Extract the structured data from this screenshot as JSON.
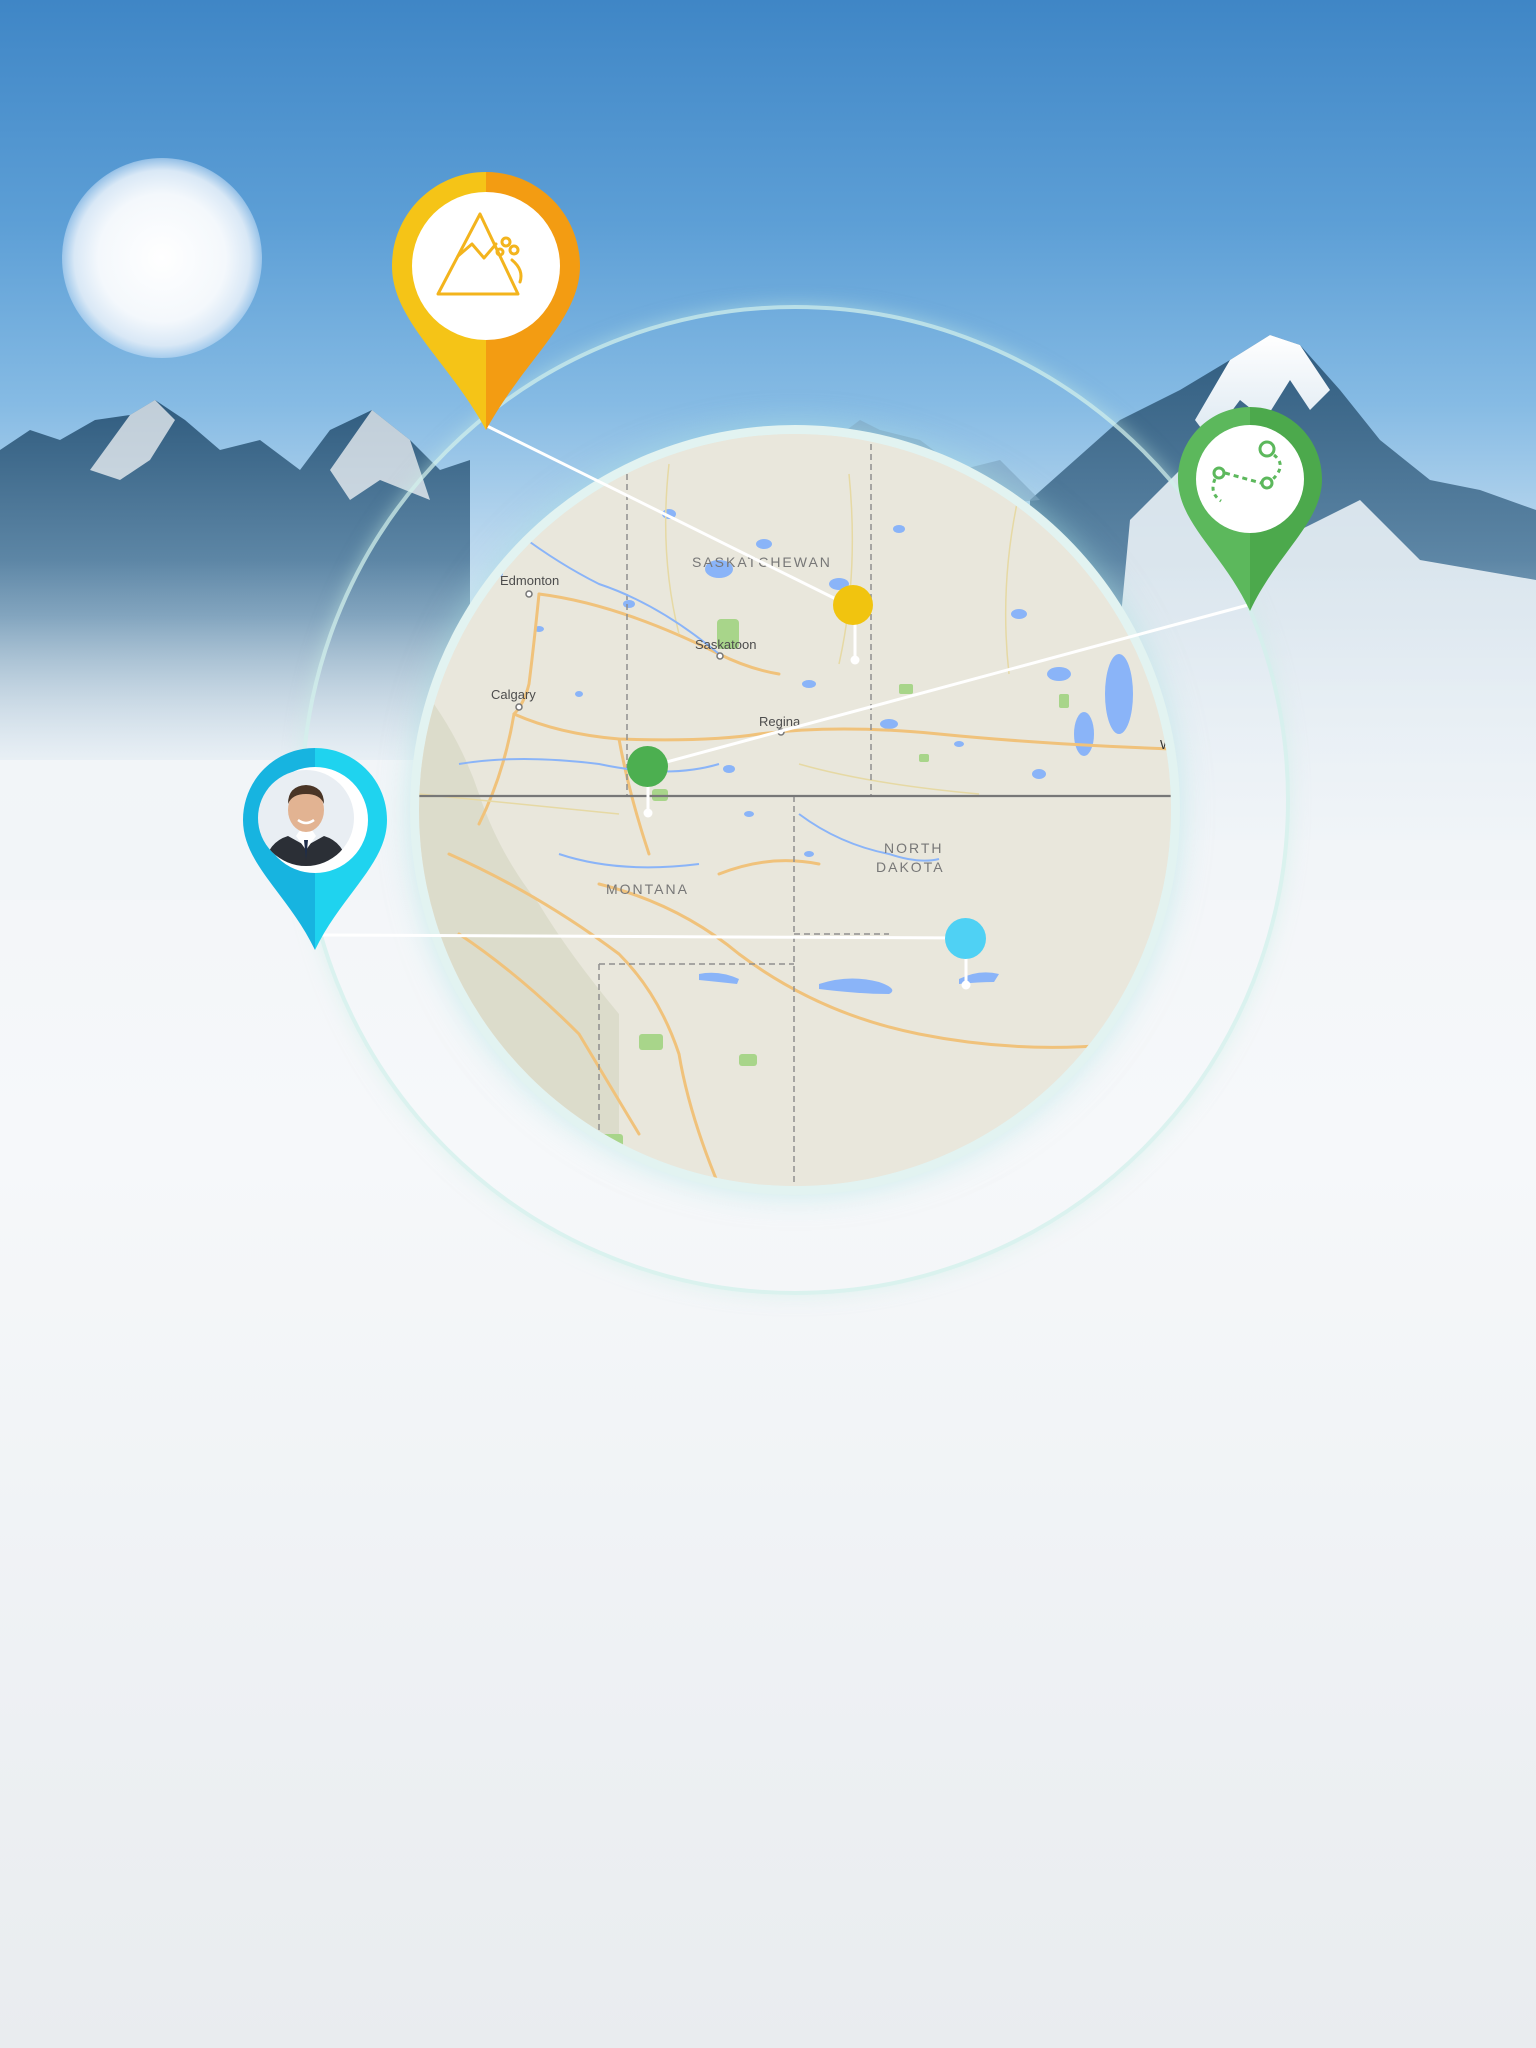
{
  "colors": {
    "yellow_pin": "#f5c417",
    "orange_pin": "#f39c12",
    "green_pin": "#5cb85c",
    "cyan_pin": "#17c6e6",
    "map_dot_yellow": "#f1c40f",
    "map_dot_green": "#4caf50",
    "map_dot_cyan": "#4fd1f4"
  },
  "map": {
    "labels": {
      "edmonton": "Edmonton",
      "calgary": "Calgary",
      "saskatchewan": "SASKATCHEWAN",
      "saskatoon": "Saskatoon",
      "regina": "Regina",
      "montana": "MONTANA",
      "north_dakota_1": "NORTH",
      "north_dakota_2": "DAKOTA",
      "winnipeg_cut": "W"
    }
  },
  "pins": [
    {
      "name": "avalanche-pin",
      "icon": "mountain-avalanche-icon",
      "color": "orange"
    },
    {
      "name": "route-pin",
      "icon": "route-path-icon",
      "color": "green"
    },
    {
      "name": "person-pin",
      "icon": "person-avatar",
      "color": "cyan"
    }
  ]
}
